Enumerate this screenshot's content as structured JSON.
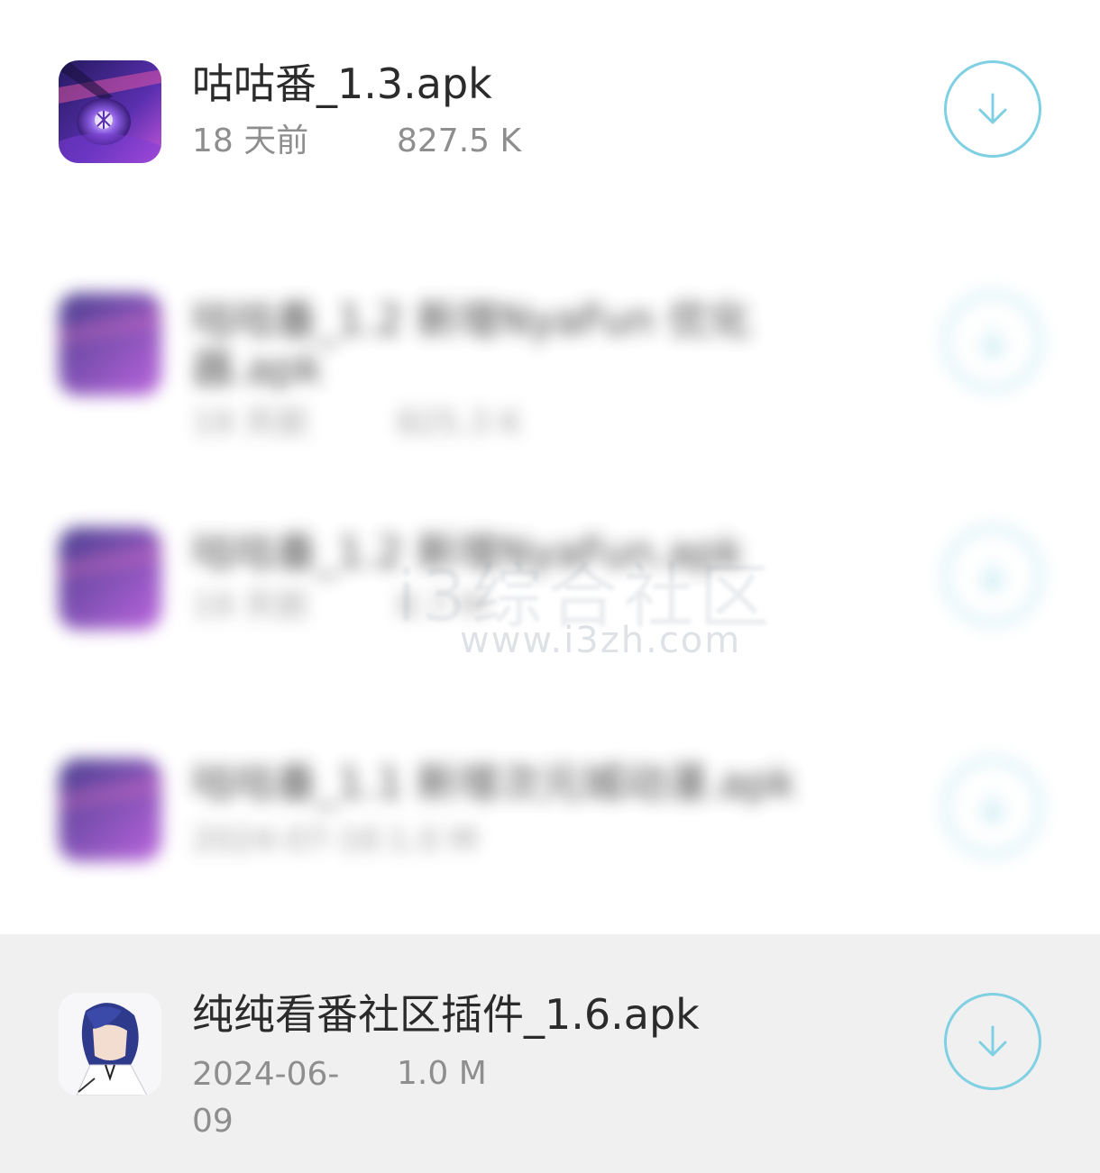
{
  "files": [
    {
      "title": "咕咕番_1.3.apk",
      "date": "18 天前",
      "size": "827.5 K",
      "icon": "anime-eye-icon",
      "blurred": false
    },
    {
      "title": "咕咕番_1.2 新增NyaFun 优化器.apk",
      "date": "19 天前",
      "size": "825.3 K",
      "icon": "anime-eye-icon",
      "blurred": true
    },
    {
      "title": "咕咕番_1.2 新增NyaFun.apk",
      "date": "19 天前",
      "size": "8.7 M",
      "icon": "anime-eye-icon",
      "blurred": true
    },
    {
      "title": "咕咕番_1.1 新增次元城动漫.apk",
      "date": "2024-07-16",
      "size": "1.0 M",
      "icon": "anime-eye-icon",
      "blurred": true
    },
    {
      "title": "纯纯看番社区插件_1.6.apk",
      "date": "2024-06-\n09",
      "size": "1.0 M",
      "icon": "anime-girl-icon",
      "blurred": false
    }
  ],
  "download_icon": "download-arrow-icon",
  "colors": {
    "accent": "#7fd0e3",
    "selected_bg": "#f0f0f0",
    "title": "#2b2b2b",
    "meta": "#8e8e8e"
  },
  "watermark": {
    "cn": "i3综合社区",
    "url": "www.i3zh.com"
  }
}
